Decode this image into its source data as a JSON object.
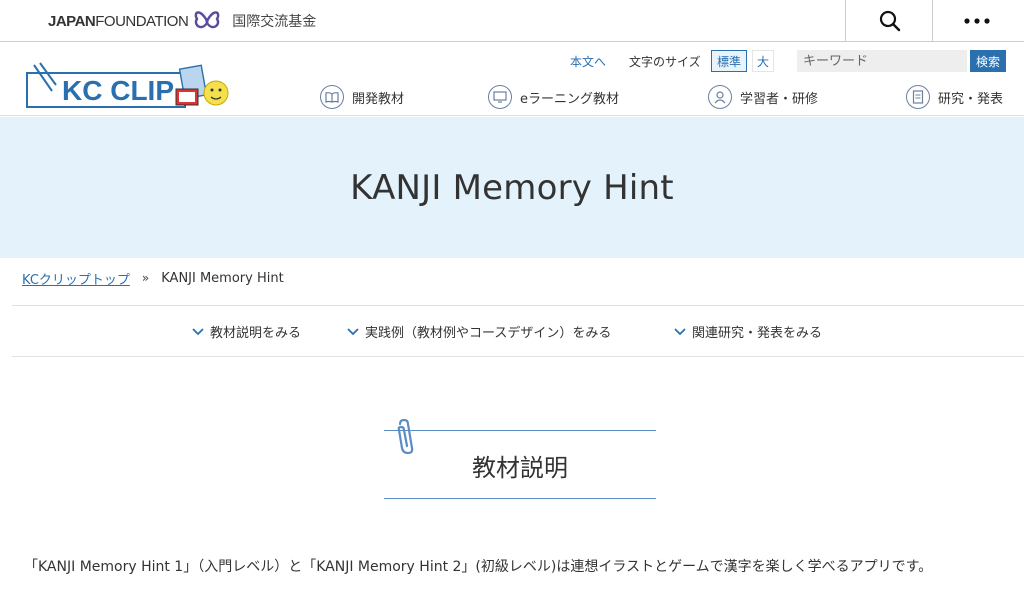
{
  "topbar": {
    "brand_bold": "JAPAN",
    "brand_rest": "FOUNDATION",
    "brand_jp": "国際交流基金",
    "search_icon": "search-icon",
    "more_icon": "more-icon"
  },
  "header": {
    "logo_text": "KC CLIP",
    "main_text_link": "本文へ",
    "font_size_label": "文字のサイズ",
    "size_standard": "標準",
    "size_large": "大",
    "keyword_placeholder": "キーワード",
    "search_button": "検索",
    "nav": [
      {
        "label": "開発教材",
        "icon": "book-icon"
      },
      {
        "label": "eラーニング教材",
        "icon": "monitor-icon"
      },
      {
        "label": "学習者・研修",
        "icon": "person-icon"
      },
      {
        "label": "研究・発表",
        "icon": "document-icon"
      }
    ]
  },
  "hero": {
    "title": "KANJI Memory Hint"
  },
  "breadcrumb": {
    "home": "KCクリップトップ",
    "separator": "»",
    "current": "KANJI Memory Hint"
  },
  "anchors": [
    "教材説明をみる",
    "実践例（教材例やコースデザイン）をみる",
    "関連研究・発表をみる"
  ],
  "section": {
    "title": "教材説明"
  },
  "intro": {
    "text": "「KANJI Memory Hint 1」（入門レベル）と「KANJI Memory Hint 2」(初級レベル)は連想イラストとゲームで漢字を楽しく学べるアプリです。"
  },
  "colors": {
    "accent": "#2a6fb0",
    "hero_bg": "#e4f3fb",
    "jf_purple": "#5b4a9e"
  }
}
